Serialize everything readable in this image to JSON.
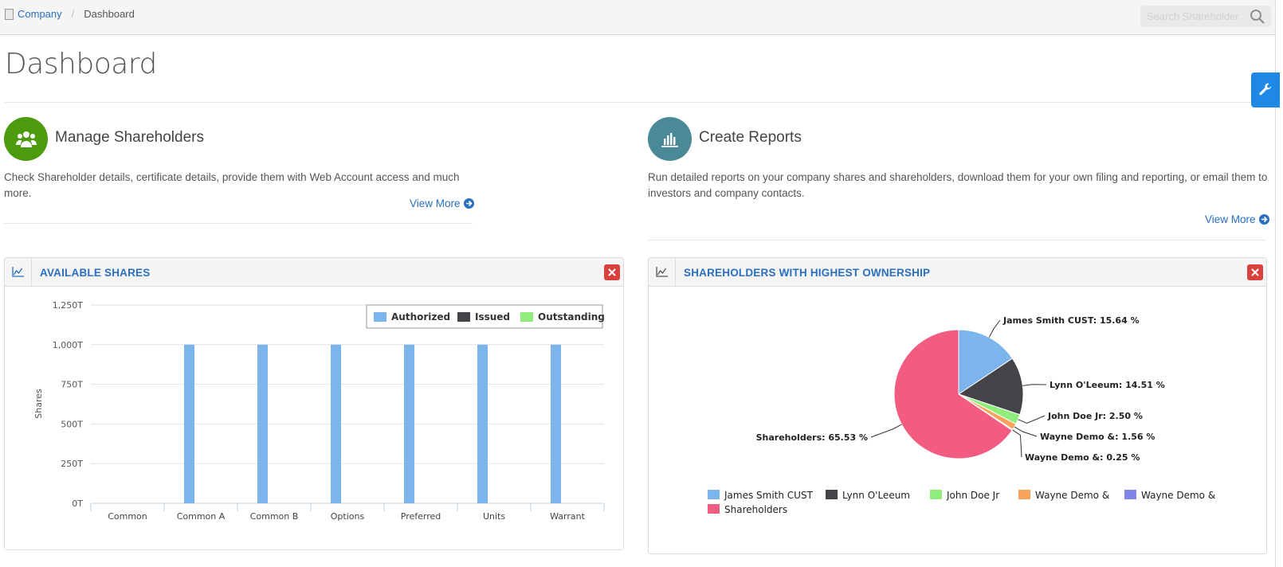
{
  "breadcrumb": {
    "company": "Company",
    "separator": "/",
    "current": "Dashboard"
  },
  "search": {
    "placeholder": "Search Shareholder"
  },
  "page": {
    "title": "Dashboard"
  },
  "manage": {
    "title": "Manage Shareholders",
    "description": "Check Shareholder details, certificate details, provide them with Web Account access and much more.",
    "link": "View More",
    "icon": "users-icon",
    "color": "#4c9a0e"
  },
  "reports": {
    "title": "Create Reports",
    "description_line1": "Run detailed reports on your company shares and shareholders, download them for your own filing and reporting, or email them to",
    "description_line2": "investors and company contacts.",
    "link": "View More",
    "icon": "bar-chart-icon",
    "color": "#4a8a96"
  },
  "panels": {
    "shares": {
      "title": "AVAILABLE SHARES"
    },
    "ownership": {
      "title": "SHAREHOLDERS WITH HIGHEST OWNERSHIP"
    }
  },
  "colors": {
    "accent": "#2a6fc0",
    "close": "#d9433f",
    "settings": "#1e88e5"
  },
  "chart_data": [
    {
      "type": "bar",
      "ylabel": "Shares",
      "ylim": [
        0,
        1250
      ],
      "yticks": [
        "0T",
        "250T",
        "500T",
        "750T",
        "1,000T",
        "1,250T"
      ],
      "categories": [
        "Common",
        "Common A",
        "Common B",
        "Options",
        "Preferred",
        "Units",
        "Warrant"
      ],
      "legend_position": "top-right",
      "series": [
        {
          "name": "Authorized",
          "color": "#7cb5ec",
          "values": [
            0,
            1000,
            1000,
            1000,
            1000,
            1000,
            1000
          ]
        },
        {
          "name": "Issued",
          "color": "#434348",
          "values": [
            0,
            0,
            0,
            0,
            0,
            0,
            0
          ]
        },
        {
          "name": "Outstanding",
          "color": "#90ed7d",
          "values": [
            0,
            0,
            0,
            0,
            0,
            0,
            0
          ]
        }
      ]
    },
    {
      "type": "pie",
      "legend_position": "bottom",
      "slices": [
        {
          "name": "James Smith CUST",
          "label": "James Smith CUST: 15.64 %",
          "value": 15.64,
          "color": "#7cb5ec"
        },
        {
          "name": "Lynn O'Leeum",
          "label": "Lynn O'Leeum: 14.51 %",
          "value": 14.51,
          "color": "#434348"
        },
        {
          "name": "John Doe Jr",
          "label": "John Doe Jr: 2.50 %",
          "value": 2.5,
          "color": "#90ed7d"
        },
        {
          "name": "Wayne Demo &",
          "label": "Wayne Demo &: 1.56 %",
          "value": 1.56,
          "color": "#f7a35c"
        },
        {
          "name": "Wayne Demo &",
          "label": "Wayne Demo &: 0.25 %",
          "value": 0.25,
          "color": "#8085e9"
        },
        {
          "name": "Shareholders",
          "label": "Shareholders: 65.53 %",
          "value": 65.53,
          "color": "#f15c80"
        }
      ]
    }
  ]
}
